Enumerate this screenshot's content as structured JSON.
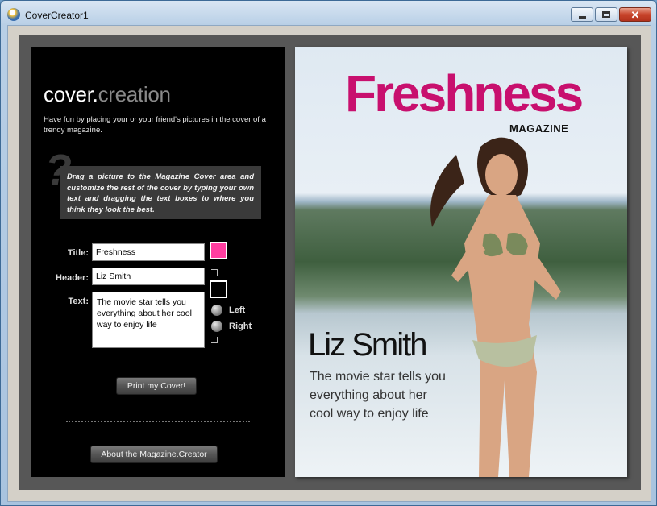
{
  "window": {
    "title": "CoverCreator1"
  },
  "brand": {
    "part1": "cover.",
    "part2": "creation"
  },
  "tagline": "Have fun by placing your or your friend's pictures in the cover of a trendy magazine.",
  "help": {
    "text": "Drag a picture to the Magazine Cover area and customize the rest of the cover by typing your own text and dragging the text boxes to where you think they look the best."
  },
  "form": {
    "title_label": "Title:",
    "title_value": "Freshness",
    "header_label": "Header:",
    "header_value": "Liz Smith",
    "text_label": "Text:",
    "text_value": "The movie star tells you everything about her cool way to enjoy life",
    "title_color": "#ff3ea0",
    "header_color": "#000000",
    "align_left": "Left",
    "align_right": "Right"
  },
  "buttons": {
    "print": "Print my Cover!",
    "about": "About the Magazine.Creator"
  },
  "cover": {
    "title": "Freshness",
    "subtitle": "MAGAZINE",
    "header": "Liz Smith",
    "text": "The movie star tells you everything about her cool way to enjoy life",
    "title_color": "#c8106e"
  }
}
